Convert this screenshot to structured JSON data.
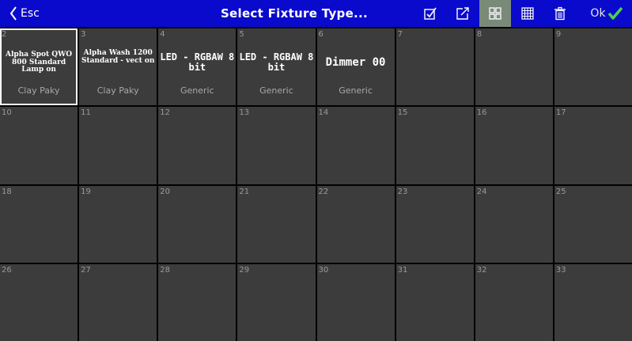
{
  "header": {
    "back_label": "Esc",
    "title": "Select Fixture Type...",
    "ok_label": "Ok",
    "accent_color": "#0a0acc",
    "active_view": "grid"
  },
  "toolbar": {
    "buttons": [
      {
        "icon": "check-box-icon",
        "name": "select-button"
      },
      {
        "icon": "export-icon",
        "name": "export-button"
      },
      {
        "icon": "grid-view-icon",
        "name": "grid-view-button"
      },
      {
        "icon": "table-view-icon",
        "name": "table-view-button"
      },
      {
        "icon": "trash-icon",
        "name": "delete-button"
      }
    ]
  },
  "fixtures": [
    {
      "number": "2",
      "name": "Alpha Spot QWO 800 Standard Lamp on",
      "manufacturer": "Clay Paky",
      "selected": true
    },
    {
      "number": "3",
      "name": "Alpha Wash 1200 Standard - vect on",
      "manufacturer": "Clay Paky"
    },
    {
      "number": "4",
      "name": "LED - RGBAW 8 bit",
      "manufacturer": "Generic"
    },
    {
      "number": "5",
      "name": "LED - RGBAW 8 bit",
      "manufacturer": "Generic"
    },
    {
      "number": "6",
      "name": "Dimmer 00",
      "manufacturer": "Generic"
    },
    {
      "number": "7"
    },
    {
      "number": "8"
    },
    {
      "number": "9"
    },
    {
      "number": "10"
    },
    {
      "number": "11"
    },
    {
      "number": "12"
    },
    {
      "number": "13"
    },
    {
      "number": "14"
    },
    {
      "number": "15"
    },
    {
      "number": "16"
    },
    {
      "number": "17"
    },
    {
      "number": "18"
    },
    {
      "number": "19"
    },
    {
      "number": "20"
    },
    {
      "number": "21"
    },
    {
      "number": "22"
    },
    {
      "number": "23"
    },
    {
      "number": "24"
    },
    {
      "number": "25"
    },
    {
      "number": "26"
    },
    {
      "number": "27"
    },
    {
      "number": "28"
    },
    {
      "number": "29"
    },
    {
      "number": "30"
    },
    {
      "number": "31"
    },
    {
      "number": "32"
    },
    {
      "number": "33"
    }
  ]
}
